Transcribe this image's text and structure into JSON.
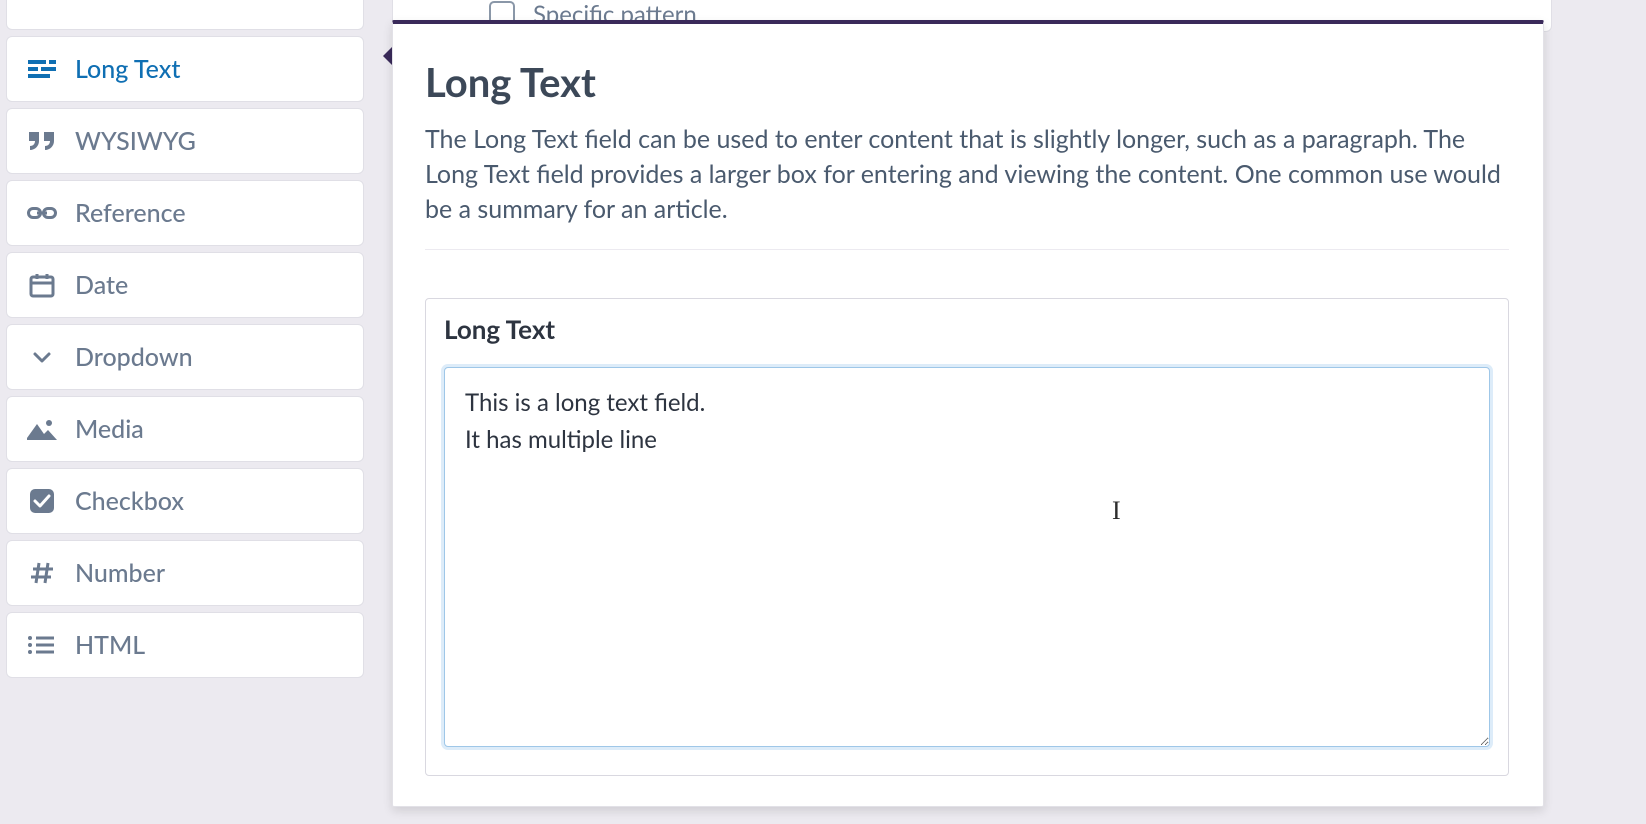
{
  "bg_peek": {
    "label": "Specific pattern"
  },
  "sidebar": {
    "items": [
      {
        "label": "Long Text",
        "icon": "long-text",
        "active": true
      },
      {
        "label": "WYSIWYG",
        "icon": "quote",
        "active": false
      },
      {
        "label": "Reference",
        "icon": "link",
        "active": false
      },
      {
        "label": "Date",
        "icon": "calendar",
        "active": false
      },
      {
        "label": "Dropdown",
        "icon": "chevron-down",
        "active": false
      },
      {
        "label": "Media",
        "icon": "image",
        "active": false
      },
      {
        "label": "Checkbox",
        "icon": "checkbox",
        "active": false
      },
      {
        "label": "Number",
        "icon": "hash",
        "active": false
      },
      {
        "label": "HTML",
        "icon": "list",
        "active": false
      }
    ]
  },
  "panel": {
    "title": "Long Text",
    "description": "The Long Text field can be used to enter content that is slightly longer, such as a paragraph. The Long Text field provides a larger box for entering and viewing the content. One common use would be a summary for an article.",
    "field_label": "Long Text",
    "field_value": "This is a long text field.\nIt has multiple line"
  },
  "colors": {
    "accent": "#3a2a5a",
    "active_text": "#0f6fb3",
    "muted": "#6b7a8f"
  },
  "cursor_glyph": "I"
}
